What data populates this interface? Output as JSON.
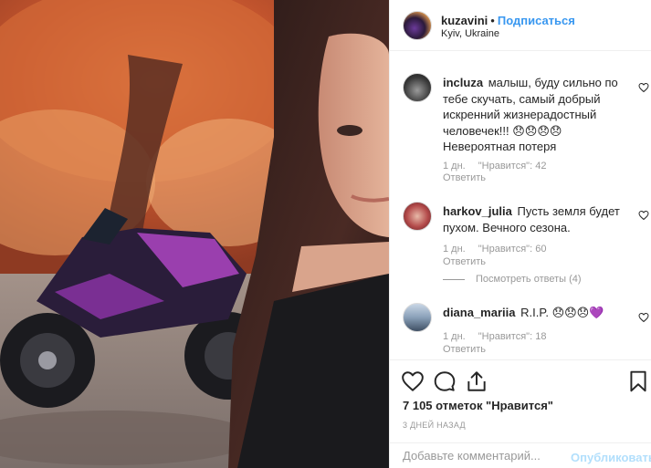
{
  "post": {
    "author": "kuzavini",
    "separator": "•",
    "follow_label": "Подписаться",
    "location": "Kyiv, Ukraine"
  },
  "comments": [
    {
      "user": "incluza",
      "text": "малыш, буду сильно по тебе скучать, самый добрый искренний жизнерадостный человечек!!! 😞😞😞😞 Невероятная потеря",
      "time": "1 дн.",
      "likes": "\"Нравится\": 42",
      "reply_label": "Ответить"
    },
    {
      "user": "harkov_julia",
      "text": "Пусть земля будет пухом. Вечного сезона.",
      "time": "1 дн.",
      "likes": "\"Нравится\": 60",
      "reply_label": "Ответить",
      "view_replies": "Посмотреть ответы (4)"
    },
    {
      "user": "diana_mariia",
      "text": "R.I.P. 😞😞😞💜",
      "time": "1 дн.",
      "likes": "\"Нравится\": 18",
      "reply_label": "Ответить"
    }
  ],
  "actions": {
    "like_icon": "heart-icon",
    "comment_icon": "comment-bubble-icon",
    "share_icon": "share-icon",
    "save_icon": "bookmark-icon",
    "likes_count": "7 105 отметок \"Нравится\"",
    "date": "3 ДНЕЙ НАЗАД"
  },
  "add_comment": {
    "placeholder": "Добавьте комментарий...",
    "publish_label": "Опубликовать"
  },
  "colors": {
    "accent": "#3897f0",
    "muted": "#999999",
    "publish_disabled": "#b2dffc",
    "text": "#262626"
  }
}
